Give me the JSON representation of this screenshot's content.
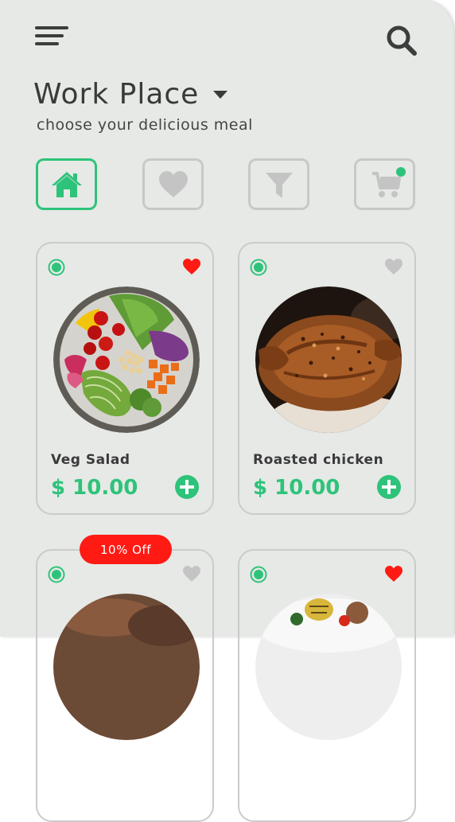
{
  "header": {
    "menu_icon": "hamburger-menu-icon",
    "search_icon": "search-icon",
    "title": "Work Place",
    "subtitle": "choose your delicious meal"
  },
  "categories": [
    {
      "icon": "home-icon",
      "active": true
    },
    {
      "icon": "heart-icon",
      "active": false
    },
    {
      "icon": "filter-icon",
      "active": false
    },
    {
      "icon": "stroller-icon",
      "active": false,
      "notification": true
    }
  ],
  "products": [
    {
      "name": "Veg Salad",
      "price": "$ 10.00",
      "favorite": true,
      "image": "salad-bowl"
    },
    {
      "name": "Roasted chicken",
      "price": "$ 10.00",
      "favorite": false,
      "image": "roasted-chicken"
    },
    {
      "name": "",
      "price": "",
      "favorite": false,
      "badge": "10% Off",
      "image": "meat-dish"
    },
    {
      "name": "",
      "price": "",
      "favorite": true,
      "image": "plated-dish"
    }
  ],
  "colors": {
    "accent": "#2ec37a",
    "favorite": "#ff1a14",
    "inactive": "#c8c8c8",
    "background": "#e6e9e6"
  }
}
